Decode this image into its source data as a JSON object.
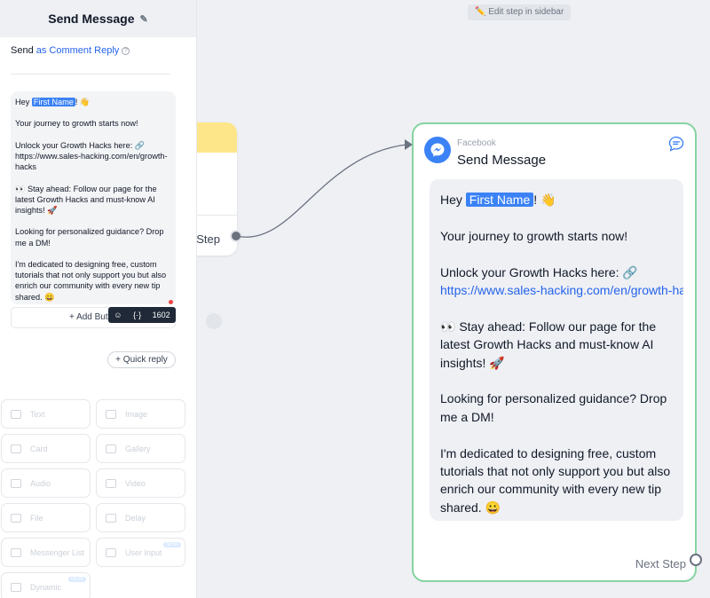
{
  "canvas": {
    "hint": "✏️ Edit step in sidebar"
  },
  "bg_node": {
    "label": "t Step"
  },
  "sidebar": {
    "title": "Send Message",
    "send_prefix": "Send ",
    "send_link": "as Comment Reply",
    "message": {
      "greeting_pre": "Hey ",
      "first_name": "First Name",
      "greeting_post": "! 👋",
      "p1": "Your journey to growth starts now!",
      "p2": "Unlock your Growth Hacks here: 🔗 https://www.sales-hacking.com/en/growth-hacks",
      "p3": "👀 Stay ahead: Follow our page for the latest Growth Hacks and must-know AI insights! 🚀",
      "p4": "Looking for personalized guidance? Drop me a DM!",
      "p5": "I'm dedicated to designing free, custom tutorials that not only support you but also enrich our community with every new tip shared. 😀"
    },
    "add_button": "+ Add Butt",
    "char_count": "1602",
    "quick_reply": "+ Quick reply",
    "tiles": [
      {
        "label": "Text",
        "new": ""
      },
      {
        "label": "Image",
        "new": ""
      },
      {
        "label": "Card",
        "new": ""
      },
      {
        "label": "Gallery",
        "new": ""
      },
      {
        "label": "Audio",
        "new": ""
      },
      {
        "label": "Video",
        "new": ""
      },
      {
        "label": "File",
        "new": ""
      },
      {
        "label": "Delay",
        "new": ""
      },
      {
        "label": "Messenger List",
        "new": ""
      },
      {
        "label": "User Input",
        "new": "NEW"
      },
      {
        "label": "Dynamic",
        "new": "NEW"
      }
    ]
  },
  "node": {
    "channel": "Facebook",
    "title": "Send Message",
    "greeting_pre": "Hey ",
    "first_name": "First Name",
    "greeting_post": "! 👋",
    "p1": "Your journey to growth starts now!",
    "p2_text": "Unlock your Growth Hacks here: 🔗",
    "p2_link": "https://www.sales-hacking.com/en/growth-hacks",
    "p3": "👀 Stay ahead: Follow our page for the latest Growth Hacks and must-know AI insights! 🚀",
    "p4": "Looking for personalized guidance? Drop me a DM!",
    "p5": "I'm dedicated to designing free, custom tutorials that not only support you but also enrich our community with every new tip shared. 😀",
    "next_step": "Next Step"
  },
  "colors": {
    "accent": "#3b82f6",
    "node_border": "#86d3a0",
    "link": "#2563eb"
  }
}
